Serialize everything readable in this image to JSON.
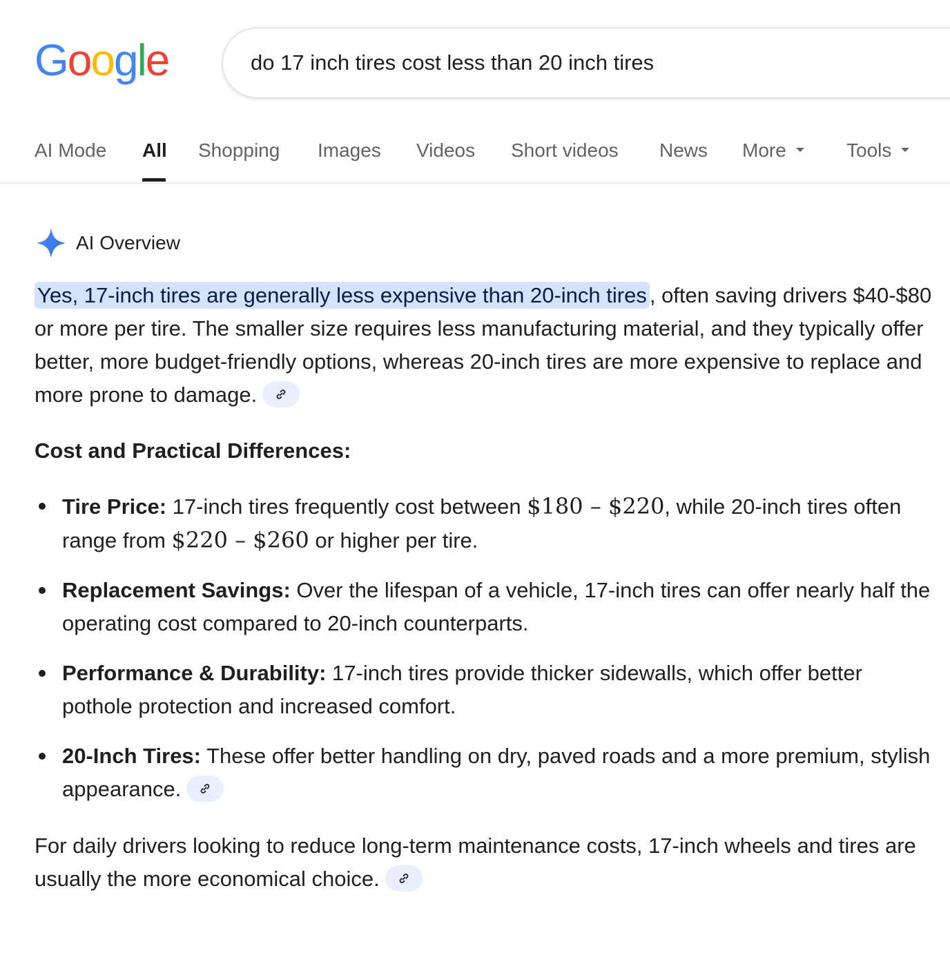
{
  "logo": {
    "letters": [
      "G",
      "o",
      "o",
      "g",
      "l",
      "e"
    ],
    "colors": [
      "#4285F4",
      "#EA4335",
      "#FBBC05",
      "#4285F4",
      "#34A853",
      "#EA4335"
    ]
  },
  "search": {
    "query": "do 17 inch tires cost less than 20 inch tires"
  },
  "tabs": [
    {
      "label": "AI Mode",
      "active": false
    },
    {
      "label": "All",
      "active": true
    },
    {
      "label": "Shopping",
      "active": false
    },
    {
      "label": "Images",
      "active": false
    },
    {
      "label": "Videos",
      "active": false
    },
    {
      "label": "Short videos",
      "active": false
    },
    {
      "label": "News",
      "active": false
    },
    {
      "label": "More",
      "active": false,
      "dropdown": true
    },
    {
      "label": "Tools",
      "active": false,
      "dropdown": true
    }
  ],
  "ai_overview": {
    "title": "AI Overview",
    "icon": "sparkle-icon",
    "accent_color": "#4285F4",
    "intro_highlight": "Yes, 17-inch tires are generally less expensive than 20-inch tires",
    "intro_rest": ", often saving drivers $40-$80 or more per tire. The smaller size requires less manufacturing material, and they typically offer better, more budget-friendly options, whereas 20-inch tires are more expensive to replace and more prone to damage.",
    "section_heading": "Cost and Practical Differences:",
    "bullets": [
      {
        "term": "Tire Price:",
        "text_a": " 17-inch tires frequently cost between ",
        "math_a": "$180 – $220",
        "text_b": ", while 20-inch tires often range from ",
        "math_b": "$220 – $260",
        "text_c": " or higher per tire."
      },
      {
        "term": "Replacement Savings:",
        "text": " Over the lifespan of a vehicle, 17-inch tires can offer nearly half the operating cost compared to 20-inch counterparts."
      },
      {
        "term": "Performance & Durability:",
        "text": " 17-inch tires provide thicker sidewalls, which offer better pothole protection and increased comfort."
      },
      {
        "term": "20-Inch Tires:",
        "text": " These offer better handling on dry, paved roads and a more premium, stylish appearance."
      }
    ],
    "closing": "For daily drivers looking to reduce long-term maintenance costs, 17-inch wheels and tires are usually the more economical choice.",
    "link_icon": "link-icon"
  }
}
